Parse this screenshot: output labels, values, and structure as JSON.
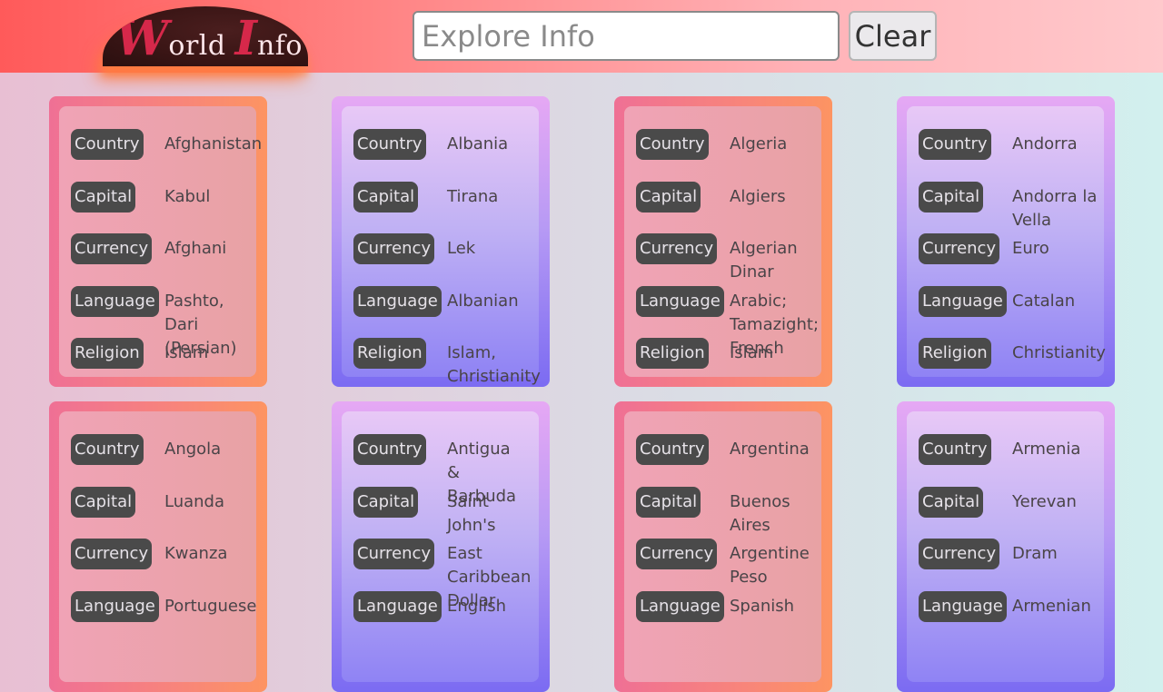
{
  "header": {
    "logo": {
      "big1": "W",
      "small1": "orld ",
      "big2": "I",
      "small2": "nfo"
    },
    "search_placeholder": "Explore Info",
    "search_value": "",
    "clear_label": "Clear"
  },
  "labels": {
    "country": "Country",
    "capital": "Capital",
    "currency": "Currency",
    "language": "Language",
    "religion": "Religion"
  },
  "cards": [
    {
      "country": "Afghanistan",
      "capital": "Kabul",
      "currency": "Afghani",
      "language": "Pashto, Dari (Persian)",
      "religion": "Islam"
    },
    {
      "country": "Albania",
      "capital": "Tirana",
      "currency": "Lek",
      "language": "Albanian",
      "religion": "Islam, Christianity"
    },
    {
      "country": "Algeria",
      "capital": "Algiers",
      "currency": "Algerian Dinar",
      "language": "Arabic; Tamazight; French",
      "religion": "Islam"
    },
    {
      "country": "Andorra",
      "capital": "Andorra la Vella",
      "currency": "Euro",
      "language": "Catalan",
      "religion": "Christianity"
    },
    {
      "country": "Angola",
      "capital": "Luanda",
      "currency": "Kwanza",
      "language": "Portuguese",
      "religion": ""
    },
    {
      "country": "Antigua & Barbuda",
      "capital": "Saint John's",
      "currency": "East Caribbean Dollar",
      "language": "English",
      "religion": ""
    },
    {
      "country": "Argentina",
      "capital": "Buenos Aires",
      "currency": "Argentine Peso",
      "language": "Spanish",
      "religion": ""
    },
    {
      "country": "Armenia",
      "capital": "Yerevan",
      "currency": "Dram",
      "language": "Armenian",
      "religion": ""
    }
  ]
}
